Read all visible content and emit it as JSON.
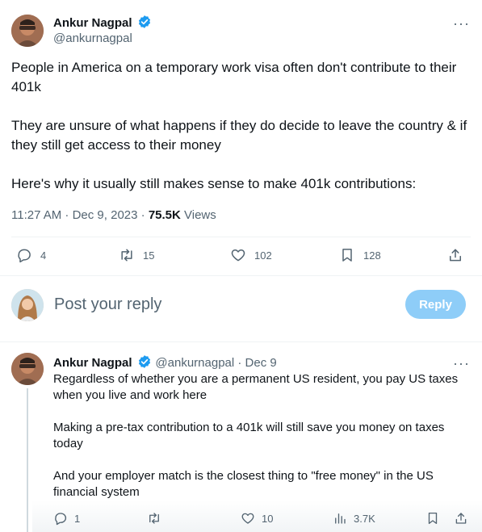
{
  "tweet": {
    "author_name": "Ankur Nagpal",
    "author_handle": "@ankurnagpal",
    "paragraphs": [
      "People in America on a temporary work visa often don't contribute to their 401k",
      "They are unsure of what happens if they do decide to leave the country & if they still get access to their money",
      "Here's why it usually still makes sense to make 401k contributions:"
    ],
    "timestamp": "11:27 AM · Dec 9, 2023 · ",
    "views_count": "75.5K",
    "views_label": " Views",
    "actions": {
      "replies": "4",
      "retweets": "15",
      "likes": "102",
      "bookmarks": "128"
    }
  },
  "composer": {
    "placeholder": "Post your reply",
    "button_label": "Reply"
  },
  "reply": {
    "author_name": "Ankur Nagpal",
    "author_handle": "@ankurnagpal",
    "date": " · Dec 9",
    "paragraphs": [
      "Regardless of whether you are a permanent US resident, you pay US taxes when you live and work here",
      "Making a pre-tax contribution to a 401k will still save you money on taxes today",
      "And your employer match is the closest thing to \"free money\" in the US financial system"
    ],
    "actions": {
      "replies": "1",
      "likes": "10",
      "views": "3.7K"
    }
  },
  "colors": {
    "verified": "#1d9bf0",
    "reply_button": "#8ecdf8",
    "secondary_text": "#536471"
  }
}
